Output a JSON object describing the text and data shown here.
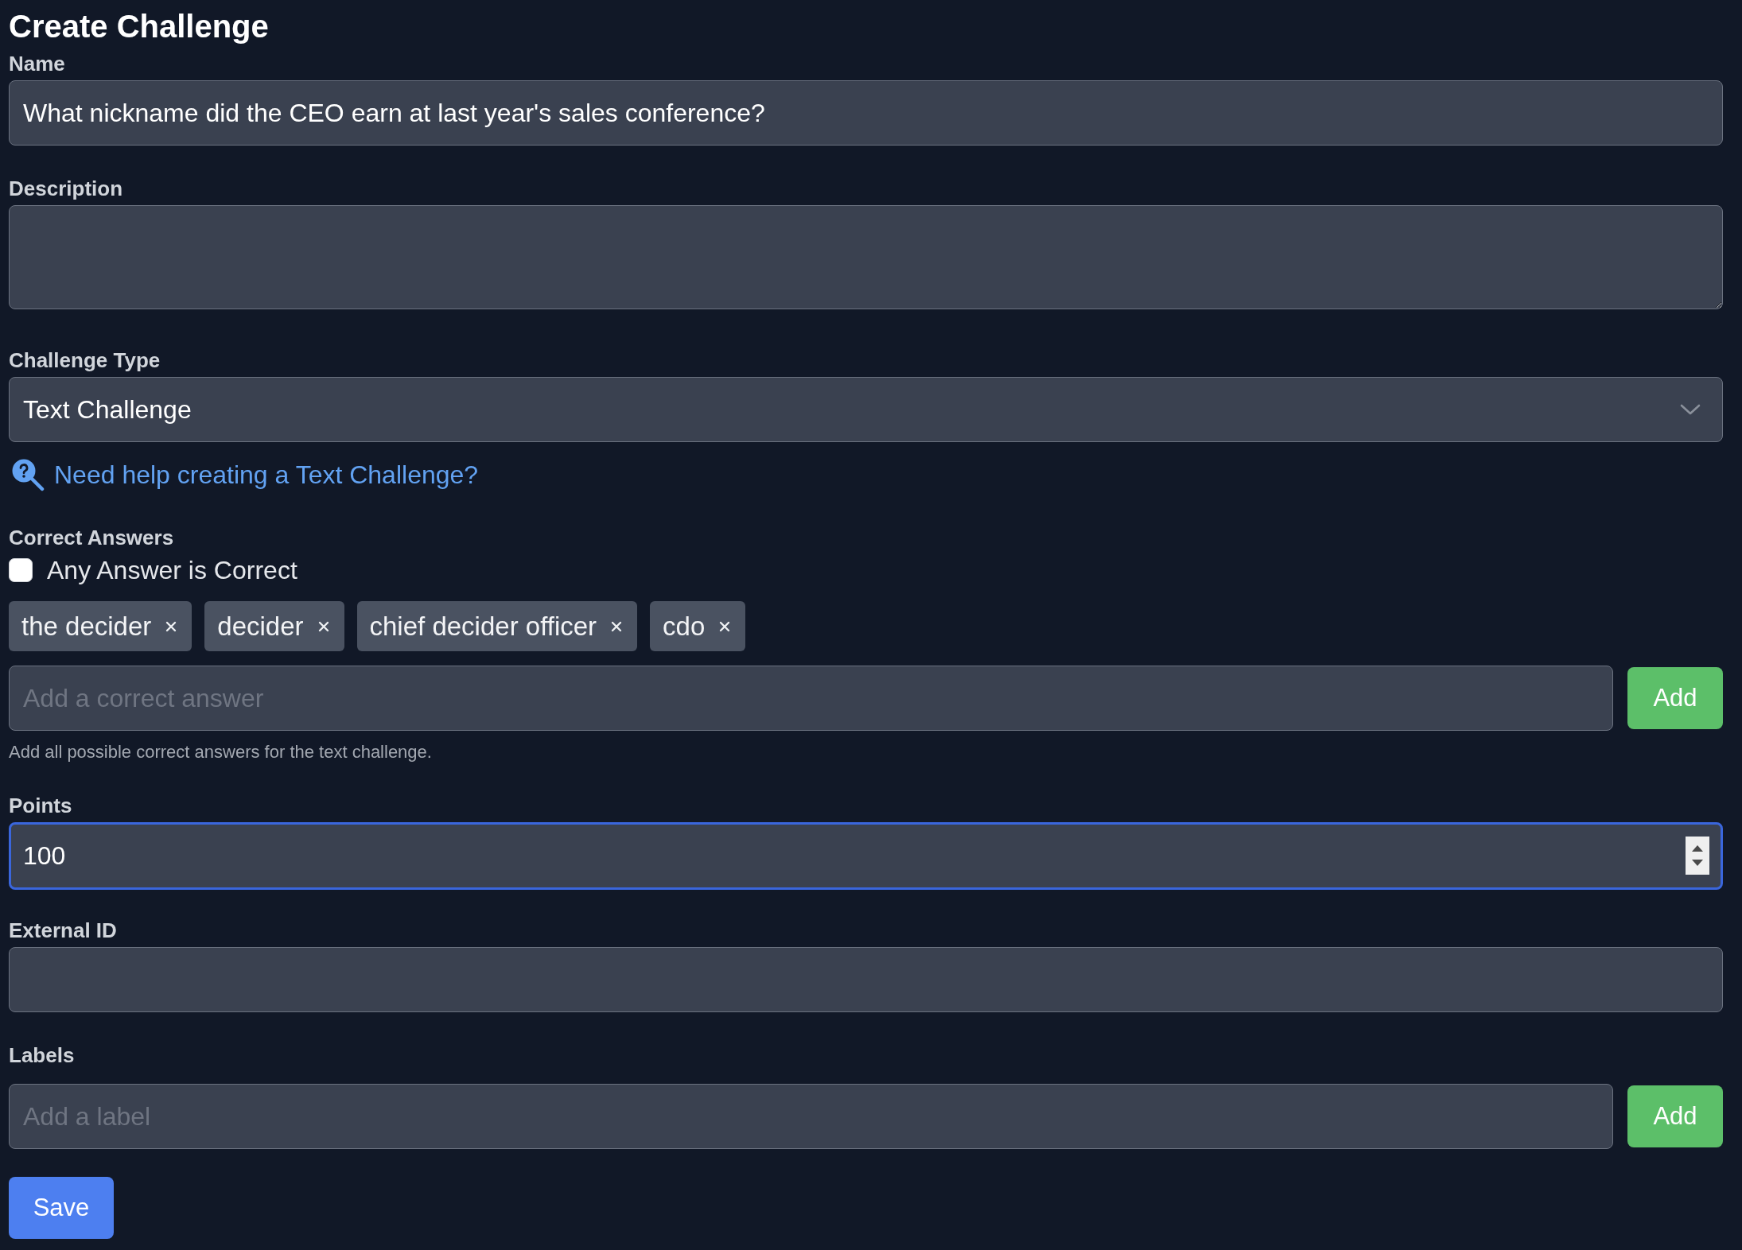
{
  "title": "Create Challenge",
  "fields": [
    {
      "kind": "text",
      "label": "Name",
      "value": "What nickname did the CEO earn at last year's sales conference?"
    },
    {
      "kind": "textarea",
      "label": "Description"
    },
    {
      "kind": "select",
      "label": "Challenge Type",
      "value": "Text Challenge"
    },
    {
      "kind": "link",
      "text": "Need help creating a Text Challenge?"
    },
    {
      "kind": "answers",
      "label": "Correct Answers",
      "checkbox": {
        "label": "Any Answer is Correct",
        "checked": false
      },
      "answers": [
        "the decider",
        "decider",
        "chief decider officer",
        "cdo"
      ],
      "placeholder": "Add a correct answer",
      "button": "Add",
      "hint": "Add all possible correct answers for the text challenge."
    },
    {
      "kind": "number",
      "label": "Points",
      "value": "100",
      "focused": true
    },
    {
      "kind": "text",
      "label": "External ID"
    },
    {
      "kind": "tag_input",
      "label": "Labels",
      "placeholder": "Add a label",
      "button": "Add"
    }
  ],
  "save_button": "Save"
}
